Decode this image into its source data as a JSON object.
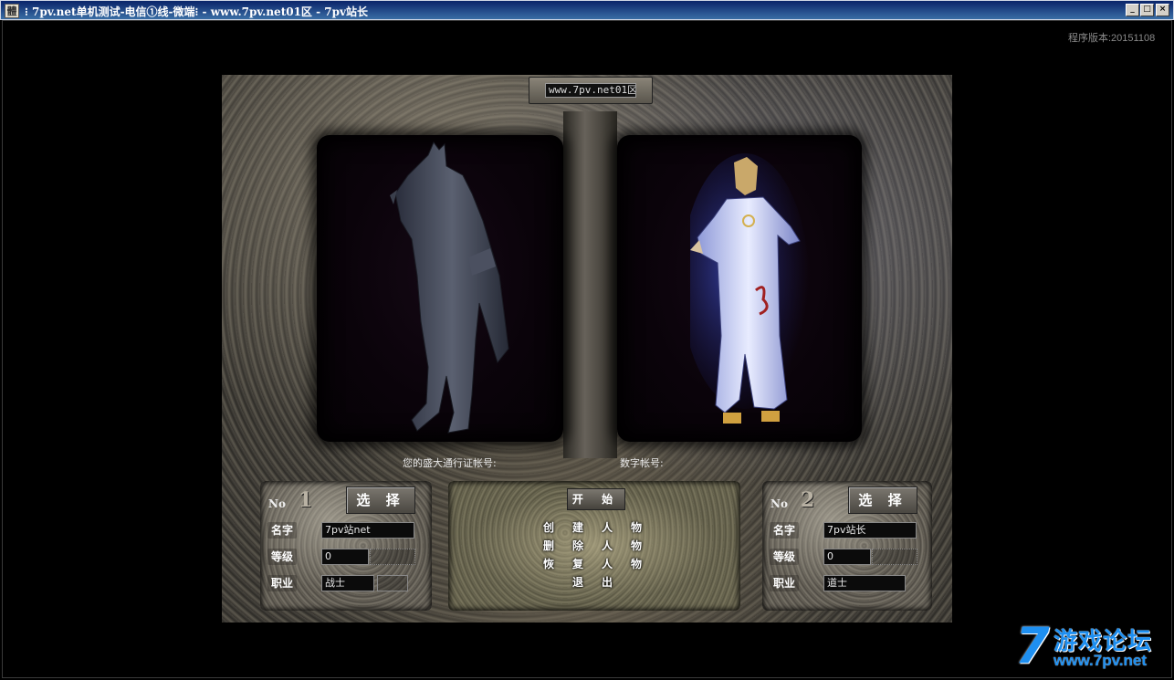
{
  "window": {
    "title": "⁝ 7pv.net单机测试-电信①线-微端⁝ - www.7pv.net01区 - 7pv站长",
    "icon_glyph": "體",
    "controls": {
      "minimize": "_",
      "maximize": "□",
      "close": "×"
    }
  },
  "version": "程序版本:20151108",
  "server": {
    "name": "www.7pv.net01区"
  },
  "account": {
    "sdo_label": "您的盛大通行证帐号:",
    "digital_label": "数字帐号:"
  },
  "slots": [
    {
      "no_label": "No",
      "no_value": "1",
      "select_label": "选 择",
      "name_label": "名字",
      "name": "7pv站net",
      "level_label": "等级",
      "level": "0",
      "job_label": "职业",
      "job": "战士"
    },
    {
      "no_label": "No",
      "no_value": "2",
      "select_label": "选 择",
      "name_label": "名字",
      "name": "7pv站长",
      "level_label": "等级",
      "level": "0",
      "job_label": "职业",
      "job": "道士"
    }
  ],
  "menu": {
    "start": "开 始",
    "create": [
      "创",
      "建",
      "人",
      "物"
    ],
    "delete": [
      "删",
      "除",
      "人",
      "物"
    ],
    "restore": [
      "恢",
      "复",
      "人",
      "物"
    ],
    "exit": [
      "退",
      "出"
    ]
  },
  "logo": {
    "digit": "7",
    "text": "游戏论坛",
    "url": "www.7pv.net"
  },
  "colors": {
    "title_bar": "#0a246a",
    "logo_blue": "#1e8ff0",
    "frame_bg": "#000000"
  }
}
